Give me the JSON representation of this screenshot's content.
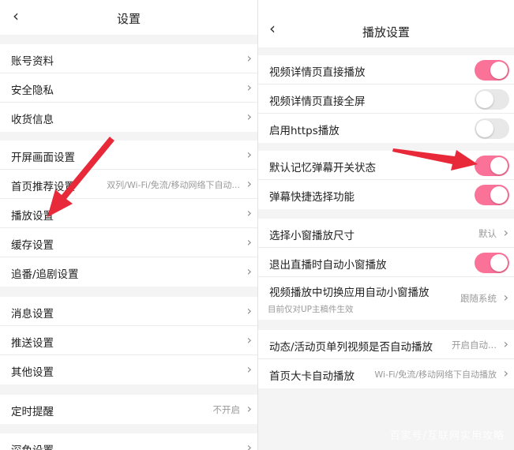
{
  "left": {
    "title": "设置",
    "back_icon": "chevron-left-icon",
    "groups": [
      {
        "items": [
          {
            "label": "账号资料"
          },
          {
            "label": "安全隐私"
          },
          {
            "label": "收货信息"
          }
        ]
      },
      {
        "items": [
          {
            "label": "开屏画面设置"
          },
          {
            "label": "首页推荐设置",
            "value": "双列/Wi-Fi/免流/移动网络下自动..."
          },
          {
            "label": "播放设置"
          },
          {
            "label": "缓存设置"
          },
          {
            "label": "追番/追剧设置"
          }
        ]
      },
      {
        "items": [
          {
            "label": "消息设置"
          },
          {
            "label": "推送设置"
          },
          {
            "label": "其他设置"
          }
        ]
      },
      {
        "items": [
          {
            "label": "定时提醒",
            "value": "不开启"
          }
        ]
      },
      {
        "items": [
          {
            "label": "深色设置"
          }
        ]
      }
    ]
  },
  "right": {
    "title": "播放设置",
    "back_icon": "chevron-left-icon",
    "groups": [
      {
        "items": [
          {
            "label": "视频详情页直接播放",
            "toggle": true
          },
          {
            "label": "视频详情页直接全屏",
            "toggle": false
          },
          {
            "label": "启用https播放",
            "toggle": false
          }
        ]
      },
      {
        "items": [
          {
            "label": "默认记忆弹幕开关状态",
            "toggle": true
          },
          {
            "label": "弹幕快捷选择功能",
            "toggle": true
          }
        ]
      },
      {
        "items": [
          {
            "label": "选择小窗播放尺寸",
            "value": "默认"
          },
          {
            "label": "退出直播时自动小窗播放",
            "toggle": true
          },
          {
            "label": "视频播放中切换应用自动小窗播放",
            "sub": "目前仅对UP主稿件生效",
            "value": "跟随系统"
          }
        ]
      },
      {
        "items": [
          {
            "label": "动态/活动页单列视频是否自动播放",
            "value": "开启自动..."
          },
          {
            "label": "首页大卡自动播放",
            "value": "Wi-Fi/免流/移动网络下自动播放"
          }
        ]
      }
    ]
  },
  "chevron": "›",
  "back_glyph": "‹",
  "watermark": "百家号/互联网实用攻略",
  "colors": {
    "accent": "#fb7299",
    "arrow": "#e8293a",
    "background": "#f4f4f4",
    "toggle_off": "#e8e8e8"
  }
}
